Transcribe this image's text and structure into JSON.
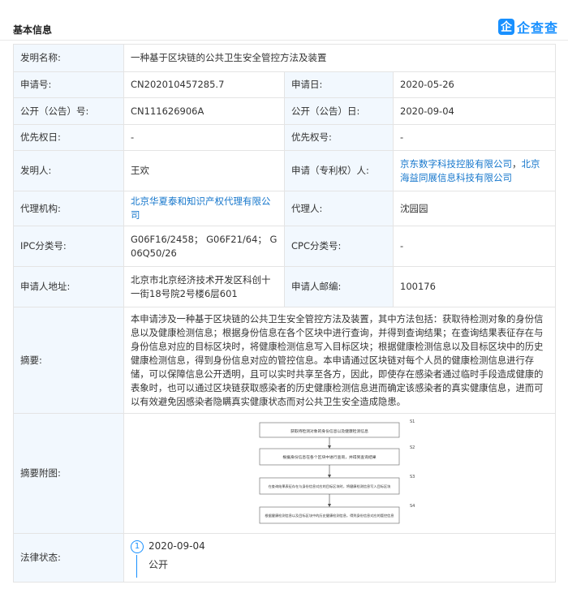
{
  "header": {
    "title": "基本信息",
    "logo_icon_text": "企",
    "logo_text": "企查查"
  },
  "rows": {
    "title_label": "发明名称:",
    "title_value": "一种基于区块链的公共卫生安全管控方法及装置",
    "app_no_label": "申请号:",
    "app_no_value": "CN202010457285.7",
    "app_date_label": "申请日:",
    "app_date_value": "2020-05-26",
    "pub_no_label": "公开（公告）号:",
    "pub_no_value": "CN111626906A",
    "pub_date_label": "公开（公告）日:",
    "pub_date_value": "2020-09-04",
    "priority_date_label": "优先权日:",
    "priority_date_value": "-",
    "priority_no_label": "优先权号:",
    "priority_no_value": "-",
    "inventor_label": "发明人:",
    "inventor_value": "王欢",
    "applicant_label": "申请（专利权）人:",
    "applicant_1": "京东数字科技控股有限公司",
    "applicant_sep": "，",
    "applicant_2": "北京海益同展信息科技有限公司",
    "agency_label": "代理机构:",
    "agency_value": "北京华夏泰和知识产权代理有限公司",
    "agent_label": "代理人:",
    "agent_value": "沈园园",
    "ipc_label": "IPC分类号:",
    "ipc_value": "G06F16/2458； G06F21/64； G06Q50/26",
    "cpc_label": "CPC分类号:",
    "cpc_value": "-",
    "address_label": "申请人地址:",
    "address_value": "北京市北京经济技术开发区科创十一街18号院2号楼6层601",
    "postcode_label": "申请人邮编:",
    "postcode_value": "100176",
    "abstract_label": "摘要:",
    "abstract_value": "本申请涉及一种基于区块链的公共卫生安全管控方法及装置，其中方法包括：获取待检测对象的身份信息以及健康检测信息；根据身份信息在各个区块中进行查询，并得到查询结果；在查询结果表征存在与身份信息对应的目标区块时，将健康检测信息写入目标区块；根据健康检测信息以及目标区块中的历史健康检测信息，得到身份信息对应的管控信息。本申请通过区块链对每个人员的健康检测信息进行存储，可以保障信息公开透明，且可以实时共享至各方，因此，即使存在感染者通过临时手段造成健康的表象时，也可以通过区块链获取感染者的历史健康检测信息进而确定该感染者的真实健康信息，进而可以有效避免因感染者隐瞒真实健康状态而对公共卫生安全造成隐患。",
    "figure_label": "摘要附图:",
    "legal_label": "法律状态:"
  },
  "flowchart": {
    "steps": [
      {
        "id": "S1",
        "text": "获取待检测对象的身份信息以及健康检测信息"
      },
      {
        "id": "S2",
        "text": "根据身份信息在各个区块中进行查询，并得到查询结果"
      },
      {
        "id": "S3",
        "text": "在查询结果表征存在与身份信息对应的目标区块时，将健康检测信息写入目标区块"
      },
      {
        "id": "S4",
        "text": "根据健康检测信息以及目标区块中的历史健康检测信息，得到身份信息对应的管控信息"
      }
    ]
  },
  "legal": {
    "index": "1",
    "date": "2020-09-04",
    "status": "公开"
  }
}
